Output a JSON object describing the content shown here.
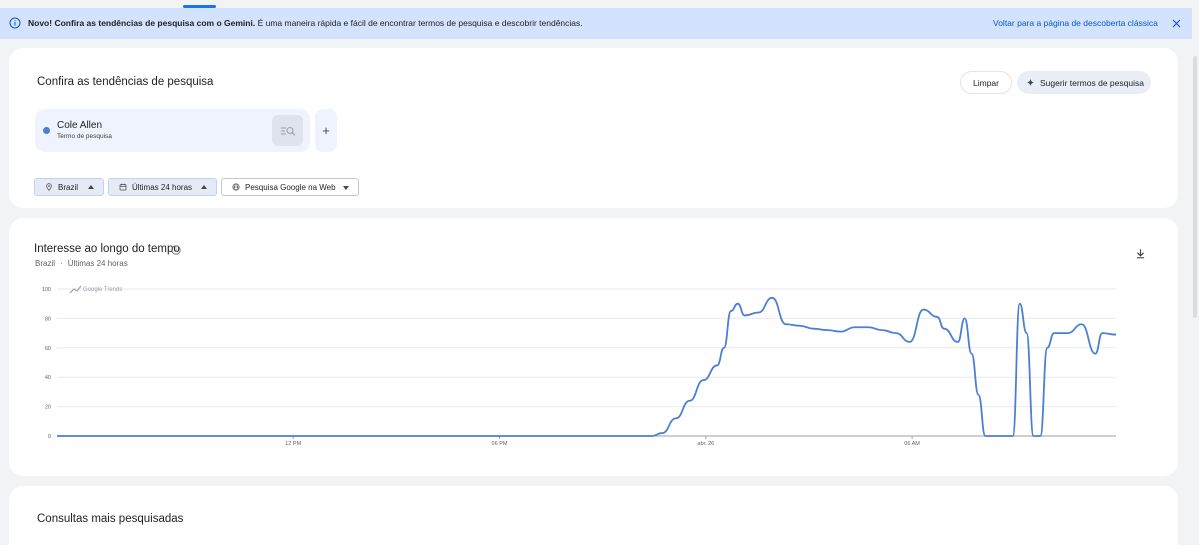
{
  "banner": {
    "bold": "Novo! Confira as tendências de pesquisa com o Gemini.",
    "text": " É uma maneira rápida e fácil de encontrar termos de pesquisa e descobrir tendências.",
    "back_link": "Voltar para a página de descoberta clássica"
  },
  "explore": {
    "title": "Confira as tendências de pesquisa",
    "clear_label": "Limpar",
    "suggest_label": "Sugerir termos de pesquisa",
    "term": {
      "name": "Cole Allen",
      "type": "Termo de pesquisa",
      "color": "#4a7fd4"
    },
    "add_label": "+",
    "filters": {
      "region": "Brazil",
      "time": "Últimas 24 horas",
      "property": "Pesquisa Google na Web"
    }
  },
  "interest": {
    "title": "Interesse ao longo do tempo",
    "region": "Brazil",
    "sep": "·",
    "time": "Últimas 24 horas"
  },
  "chart_data": {
    "type": "line",
    "watermark": "Google Trends",
    "ylim": [
      0,
      100
    ],
    "yticks": [
      0,
      20,
      40,
      60,
      80,
      100
    ],
    "xticks": [
      {
        "x": 6.87,
        "label": "12 PM"
      },
      {
        "x": 12.87,
        "label": "06 PM"
      },
      {
        "x": 18.87,
        "label": "abr. 26"
      },
      {
        "x": 24.87,
        "label": "06 AM"
      }
    ],
    "xlim": [
      0,
      28.6
    ],
    "series": [
      {
        "color": "#4a7fd4",
        "points": [
          [
            0,
            0
          ],
          [
            16.0,
            0
          ],
          [
            17.3,
            0
          ],
          [
            17.6,
            2
          ],
          [
            18.0,
            12
          ],
          [
            18.4,
            24
          ],
          [
            18.8,
            38
          ],
          [
            19.2,
            48
          ],
          [
            19.4,
            60
          ],
          [
            19.6,
            85
          ],
          [
            19.8,
            90
          ],
          [
            20.0,
            82
          ],
          [
            20.4,
            84
          ],
          [
            20.8,
            94
          ],
          [
            21.2,
            76
          ],
          [
            21.6,
            75
          ],
          [
            22.0,
            73
          ],
          [
            22.4,
            72
          ],
          [
            22.8,
            71
          ],
          [
            23.2,
            74
          ],
          [
            23.6,
            74
          ],
          [
            24.0,
            72
          ],
          [
            24.4,
            70
          ],
          [
            24.8,
            64
          ],
          [
            25.2,
            86
          ],
          [
            25.6,
            81
          ],
          [
            25.8,
            73
          ],
          [
            26.2,
            64
          ],
          [
            26.4,
            80
          ],
          [
            26.6,
            56
          ],
          [
            26.8,
            28
          ],
          [
            27.0,
            0
          ],
          [
            27.4,
            0
          ],
          [
            27.8,
            0
          ],
          [
            28.0,
            90
          ],
          [
            28.2,
            70
          ],
          [
            28.4,
            0
          ],
          [
            28.6,
            0
          ],
          [
            28.8,
            60
          ],
          [
            29.0,
            70
          ],
          [
            29.4,
            70
          ],
          [
            29.8,
            76
          ],
          [
            30.2,
            56
          ],
          [
            30.4,
            70
          ],
          [
            30.8,
            69
          ]
        ]
      }
    ]
  },
  "related": {
    "title": "Consultas mais pesquisadas"
  }
}
